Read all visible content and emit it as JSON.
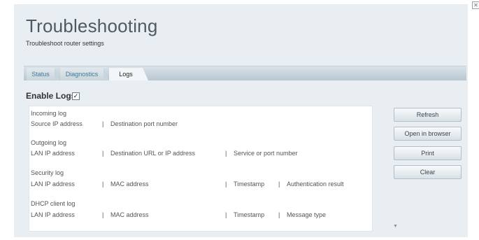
{
  "page": {
    "title": "Troubleshooting",
    "subtitle": "Troubleshoot router settings",
    "close_glyph": "✕"
  },
  "tabs": [
    {
      "label": "Status",
      "active": false
    },
    {
      "label": "Diagnostics",
      "active": false
    },
    {
      "label": "Logs",
      "active": true
    }
  ],
  "enable_logs": {
    "label": "Enable Logs",
    "checked": true,
    "check_glyph": "✓"
  },
  "logs": {
    "incoming": {
      "title": "Incoming log",
      "cols": [
        "Source IP address",
        "Destination port number"
      ]
    },
    "outgoing": {
      "title": "Outgoing log",
      "cols": [
        "LAN IP address",
        "Destination URL or IP address",
        "Service or port number"
      ]
    },
    "security": {
      "title": "Security log",
      "cols": [
        "LAN IP address",
        "MAC address",
        "Timestamp",
        "Authentication result"
      ]
    },
    "dhcp": {
      "title": "DHCP client log",
      "cols": [
        "LAN IP address",
        "MAC address",
        "Timestamp",
        "Message type"
      ]
    },
    "separator": "|"
  },
  "scrollbar": {
    "up": "▲",
    "down": "▼"
  },
  "buttons": {
    "refresh": "Refresh",
    "open_browser": "Open in browser",
    "print": "Print",
    "clear": "Clear"
  }
}
